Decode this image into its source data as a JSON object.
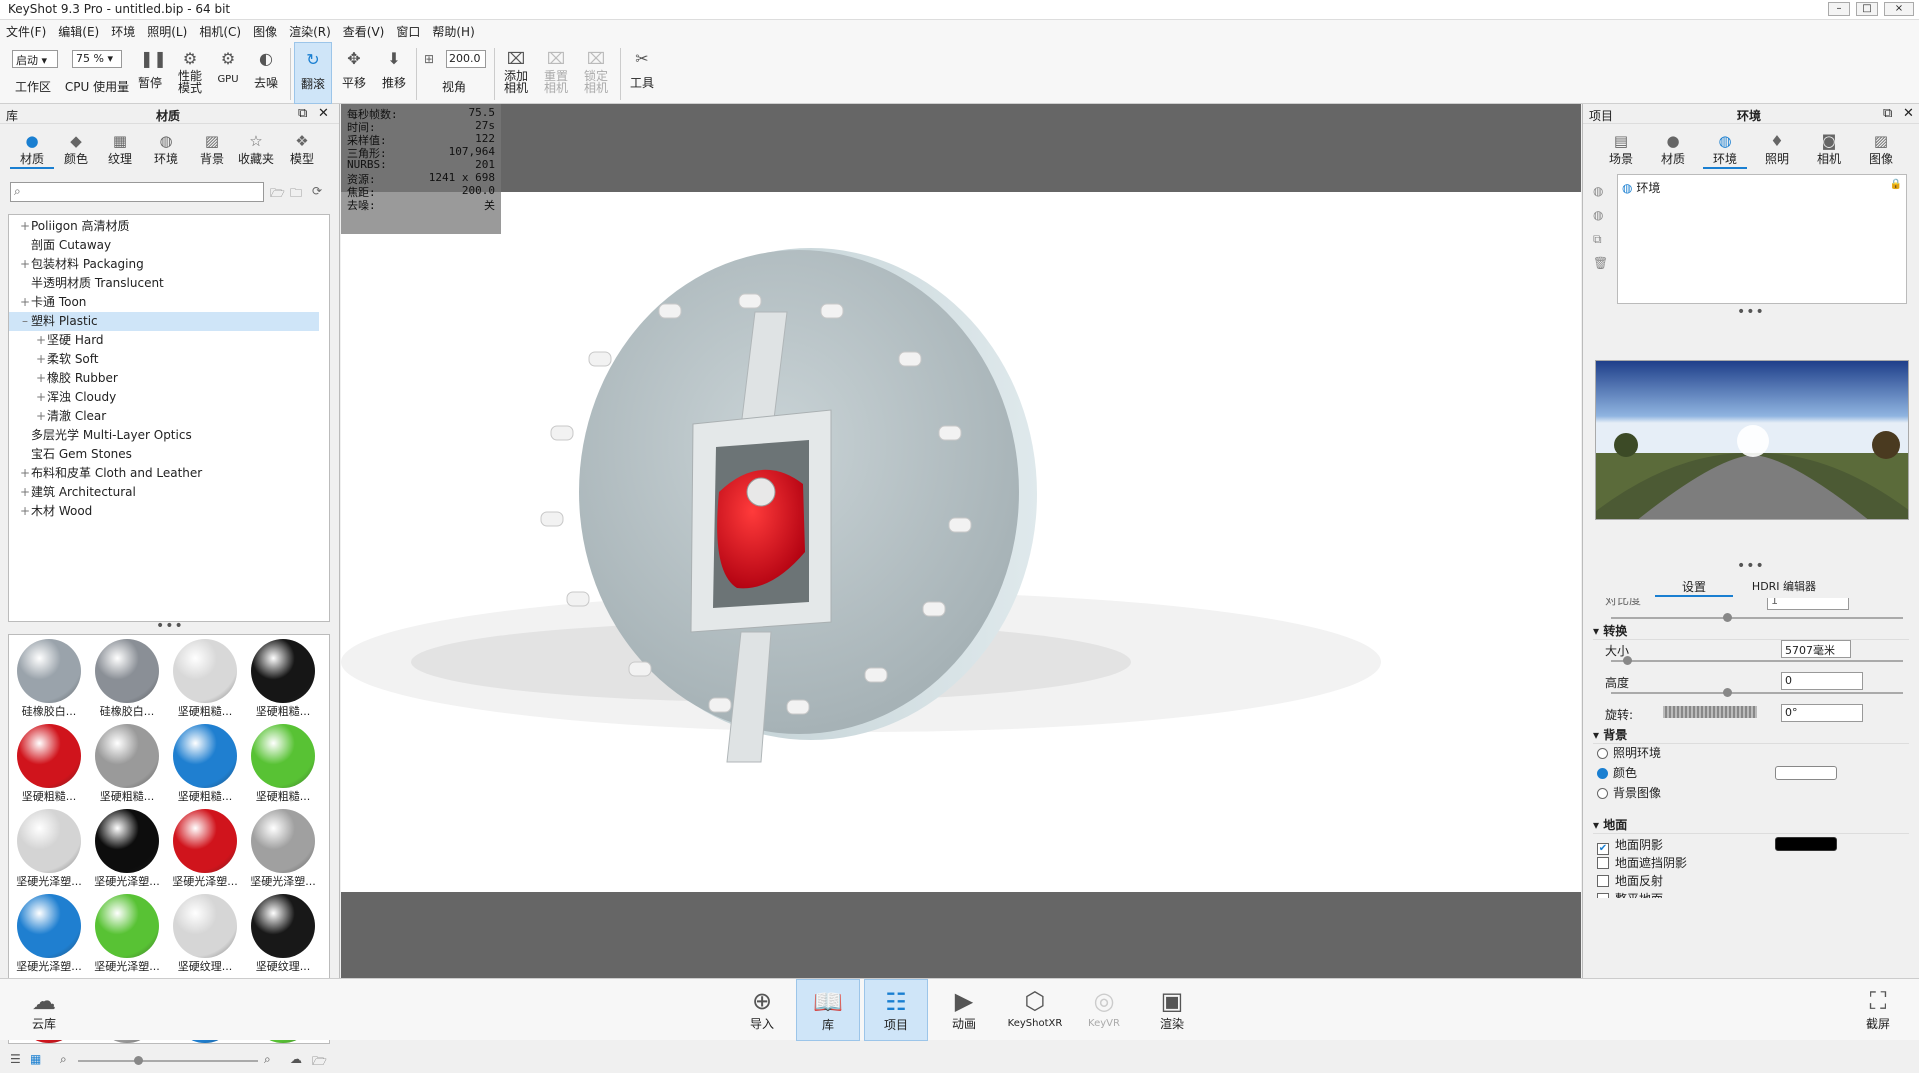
{
  "title": "KeyShot 9.3 Pro  - untitled.bip  - 64 bit",
  "window_controls": [
    "–",
    "□",
    "×"
  ],
  "menu": [
    "文件(F)",
    "编辑(E)",
    "环境",
    "照明(L)",
    "相机(C)",
    "图像",
    "渲染(R)",
    "查看(V)",
    "窗口",
    "帮助(H)"
  ],
  "toolbar": {
    "mode_select": "启动",
    "cpu_select": "75 %",
    "fov_value": "200.0",
    "workspace": "工作区",
    "cpu_usage": "CPU 使用量",
    "pause": "暂停",
    "perf_mode": "性能\n模式",
    "gpu": "GPU",
    "denoise": "去噪",
    "tumble": "翻滚",
    "pan": "平移",
    "dolly": "推移",
    "view": "视角",
    "add_camera": "添加\n相机",
    "reset_camera": "重置\n相机",
    "lock_camera": "锁定\n相机",
    "tools": "工具"
  },
  "library": {
    "header_left": "库",
    "header_center": "材质",
    "tabs": [
      "材质",
      "颜色",
      "纹理",
      "环境",
      "背景",
      "收藏夹",
      "模型"
    ],
    "search_placeholder": "",
    "tree": [
      {
        "label": "Poliigon 高清材质",
        "indent": 0,
        "pm": "+"
      },
      {
        "label": "剖面 Cutaway",
        "indent": 0,
        "pm": ""
      },
      {
        "label": "包装材料 Packaging",
        "indent": 0,
        "pm": "+"
      },
      {
        "label": "半透明材质 Translucent",
        "indent": 0,
        "pm": ""
      },
      {
        "label": "卡通 Toon",
        "indent": 0,
        "pm": "+"
      },
      {
        "label": "塑料 Plastic",
        "indent": 0,
        "pm": "–"
      },
      {
        "label": "坚硬 Hard",
        "indent": 1,
        "pm": "+"
      },
      {
        "label": "柔软 Soft",
        "indent": 1,
        "pm": "+"
      },
      {
        "label": "橡胶 Rubber",
        "indent": 1,
        "pm": "+"
      },
      {
        "label": "浑浊 Cloudy",
        "indent": 1,
        "pm": "+"
      },
      {
        "label": "清澈 Clear",
        "indent": 1,
        "pm": "+"
      },
      {
        "label": "多层光学 Multi-Layer Optics",
        "indent": 0,
        "pm": ""
      },
      {
        "label": "宝石 Gem Stones",
        "indent": 0,
        "pm": ""
      },
      {
        "label": "布料和皮革 Cloth and Leather",
        "indent": 0,
        "pm": "+"
      },
      {
        "label": "建筑 Architectural",
        "indent": 0,
        "pm": "+"
      },
      {
        "label": "木材 Wood",
        "indent": 0,
        "pm": "+"
      }
    ],
    "materials": [
      {
        "label": "硅橡胶白...",
        "color": "#9aa3ab"
      },
      {
        "label": "硅橡胶白...",
        "color": "#8a8f96"
      },
      {
        "label": "坚硬粗糙...",
        "color": "#d8d8d8"
      },
      {
        "label": "坚硬粗糙...",
        "color": "#161616"
      },
      {
        "label": "坚硬粗糙...",
        "color": "#d0141c"
      },
      {
        "label": "坚硬粗糙...",
        "color": "#9a9a9a"
      },
      {
        "label": "坚硬粗糙...",
        "color": "#1f7fd0"
      },
      {
        "label": "坚硬粗糙...",
        "color": "#58c234"
      },
      {
        "label": "坚硬光泽塑...",
        "color": "#d4d4d4"
      },
      {
        "label": "坚硬光泽塑...",
        "color": "#0d0d0d"
      },
      {
        "label": "坚硬光泽塑...",
        "color": "#d0141c"
      },
      {
        "label": "坚硬光泽塑...",
        "color": "#a0a0a0"
      },
      {
        "label": "坚硬光泽塑...",
        "color": "#1f7fd0"
      },
      {
        "label": "坚硬光泽塑...",
        "color": "#58c234"
      },
      {
        "label": "坚硬纹理...",
        "color": "#d6d6d6"
      },
      {
        "label": "坚硬纹理...",
        "color": "#181818"
      },
      {
        "label": "",
        "color": "#d0141c"
      },
      {
        "label": "",
        "color": "#9a9a9a"
      },
      {
        "label": "",
        "color": "#1f7fd0"
      },
      {
        "label": "",
        "color": "#58c234"
      }
    ]
  },
  "hud": [
    {
      "k": "每秒帧数:",
      "v": "75.5"
    },
    {
      "k": "时间:",
      "v": "27s"
    },
    {
      "k": "采样值:",
      "v": "122"
    },
    {
      "k": "三角形:",
      "v": "107,964"
    },
    {
      "k": "NURBS:",
      "v": "201"
    },
    {
      "k": "资源:",
      "v": "1241 x 698"
    },
    {
      "k": "焦距:",
      "v": "200.0"
    },
    {
      "k": "去噪:",
      "v": "关"
    }
  ],
  "project": {
    "header_left": "项目",
    "header_center": "环境",
    "tabs": [
      "场景",
      "材质",
      "环境",
      "照明",
      "相机",
      "图像"
    ],
    "env_item": "环境",
    "subtabs": [
      "设置",
      "HDRI 编辑器"
    ],
    "clipped_label": "对比度",
    "clipped_value": "1",
    "transform": {
      "title": "转换",
      "size_label": "大小",
      "size_value": "5707毫米",
      "height_label": "高度",
      "height_value": "0",
      "rotation_label": "旋转:",
      "rotation_value": "0°"
    },
    "background": {
      "title": "背景",
      "options": [
        "照明环境",
        "颜色",
        "背景图像"
      ],
      "selected": "颜色"
    },
    "ground": {
      "title": "地面",
      "options": [
        "地面阴影",
        "地面遮挡阴影",
        "地面反射",
        "整平地面"
      ],
      "checked": [
        "地面阴影"
      ]
    }
  },
  "bottom": {
    "cloud": "云库",
    "import": "导入",
    "library": "库",
    "project": "项目",
    "animation": "动画",
    "keyshotxr": "KeyShotXR",
    "keyvr": "KeyVR",
    "render": "渲染",
    "screenshot": "截屏"
  }
}
